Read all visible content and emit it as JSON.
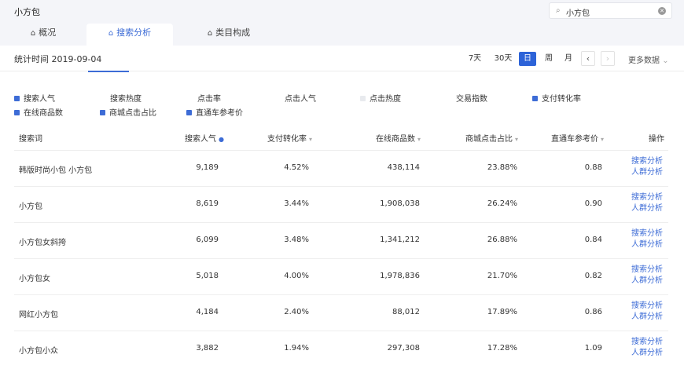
{
  "app": {
    "title": "小方包"
  },
  "search": {
    "icon": "search-icon",
    "value": "小方包",
    "clear_icon": "clear-icon"
  },
  "tabs": [
    {
      "label": "概况",
      "icon": "home-icon",
      "active": false
    },
    {
      "label": "搜索分析",
      "icon": "home-icon",
      "active": true
    },
    {
      "label": "类目构成",
      "icon": "home-icon",
      "active": false
    }
  ],
  "filter": {
    "stat_date": "统计时间 2019-09-04",
    "periods": [
      "7天",
      "30天",
      "日",
      "周",
      "月"
    ],
    "active_period": "日",
    "prev": "‹",
    "next": "›",
    "more": "更多数据"
  },
  "metrics": [
    {
      "label": "搜索人气",
      "checked": true
    },
    {
      "label": "搜索热度",
      "checked": false
    },
    {
      "label": "点击率",
      "checked": false
    },
    {
      "label": "点击人气",
      "checked": false
    },
    {
      "label": "点击热度",
      "checked": false
    },
    {
      "label": "交易指数",
      "checked": false
    },
    {
      "label": "支付转化率",
      "checked": true
    },
    {
      "label": "在线商品数",
      "checked": true
    },
    {
      "label": "商城点击占比",
      "checked": true
    },
    {
      "label": "直通车参考价",
      "checked": true
    }
  ],
  "table": {
    "headers": [
      "搜索词",
      "搜索人气",
      "支付转化率",
      "在线商品数",
      "商城点击占比",
      "直通车参考价",
      "操作"
    ],
    "rows": [
      {
        "word": "韩版时尚小包 小方包",
        "pop": "9,189",
        "conv": "4.52%",
        "items": "438,114",
        "mall": "23.88%",
        "price": "0.88"
      },
      {
        "word": "小方包",
        "pop": "8,619",
        "conv": "3.44%",
        "items": "1,908,038",
        "mall": "26.24%",
        "price": "0.90"
      },
      {
        "word": "小方包女斜挎",
        "pop": "6,099",
        "conv": "3.48%",
        "items": "1,341,212",
        "mall": "26.88%",
        "price": "0.84"
      },
      {
        "word": "小方包女",
        "pop": "5,018",
        "conv": "4.00%",
        "items": "1,978,836",
        "mall": "21.70%",
        "price": "0.82"
      },
      {
        "word": "网红小方包",
        "pop": "4,184",
        "conv": "2.40%",
        "items": "88,012",
        "mall": "17.89%",
        "price": "0.86"
      },
      {
        "word": "小方包小众",
        "pop": "3,882",
        "conv": "1.94%",
        "items": "297,308",
        "mall": "17.28%",
        "price": "1.09"
      }
    ],
    "action_1": "搜索分析",
    "action_2": "人群分析"
  }
}
